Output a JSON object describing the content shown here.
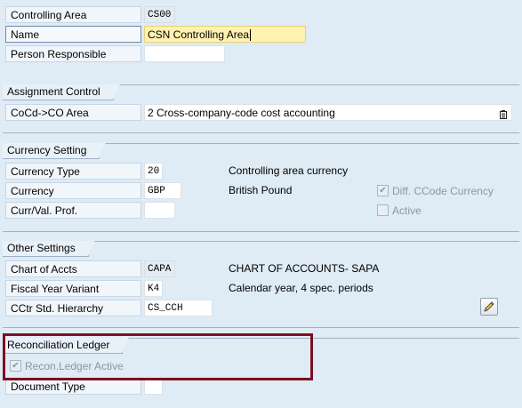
{
  "top": {
    "controlling_area": {
      "label": "Controlling Area",
      "value": "CS00"
    },
    "name": {
      "label": "Name",
      "value": "CSN Controlling Area"
    },
    "person_responsible": {
      "label": "Person Responsible",
      "value": ""
    }
  },
  "assignment_control": {
    "title": "Assignment Control",
    "cocd_co_area": {
      "label": "CoCd->CO Area",
      "value": "2 Cross-company-code cost accounting",
      "icon": "list-icon"
    }
  },
  "currency_setting": {
    "title": "Currency Setting",
    "currency_type": {
      "label": "Currency Type",
      "value": "20",
      "description": "Controlling area currency"
    },
    "currency": {
      "label": "Currency",
      "value": "GBP",
      "description": "British Pound"
    },
    "curr_val_prof": {
      "label": "Curr/Val. Prof.",
      "value": ""
    },
    "diff_ccode_currency": {
      "label": "Diff. CCode Currency",
      "checked": true
    },
    "active": {
      "label": "Active",
      "checked": false
    }
  },
  "other_settings": {
    "title": "Other Settings",
    "chart_of_accts": {
      "label": "Chart of Accts",
      "value": "CAPA",
      "description": "CHART OF ACCOUNTS- SAPA"
    },
    "fiscal_year_variant": {
      "label": "Fiscal Year Variant",
      "value": "K4",
      "description": "Calendar year, 4 spec. periods"
    },
    "cctr_std_hierarchy": {
      "label": "CCtr Std. Hierarchy",
      "value": "CS_CCH",
      "icon": "pencil-icon"
    }
  },
  "reconciliation_ledger": {
    "title": "Reconciliation Ledger",
    "recon_ledger_active": {
      "label": "Recon.Ledger Active",
      "checked": true
    },
    "document_type": {
      "label": "Document Type",
      "value": ""
    }
  },
  "colors": {
    "background": "#dfebf5",
    "highlight": "#7b1022",
    "focus_field": "#fff2b0"
  }
}
